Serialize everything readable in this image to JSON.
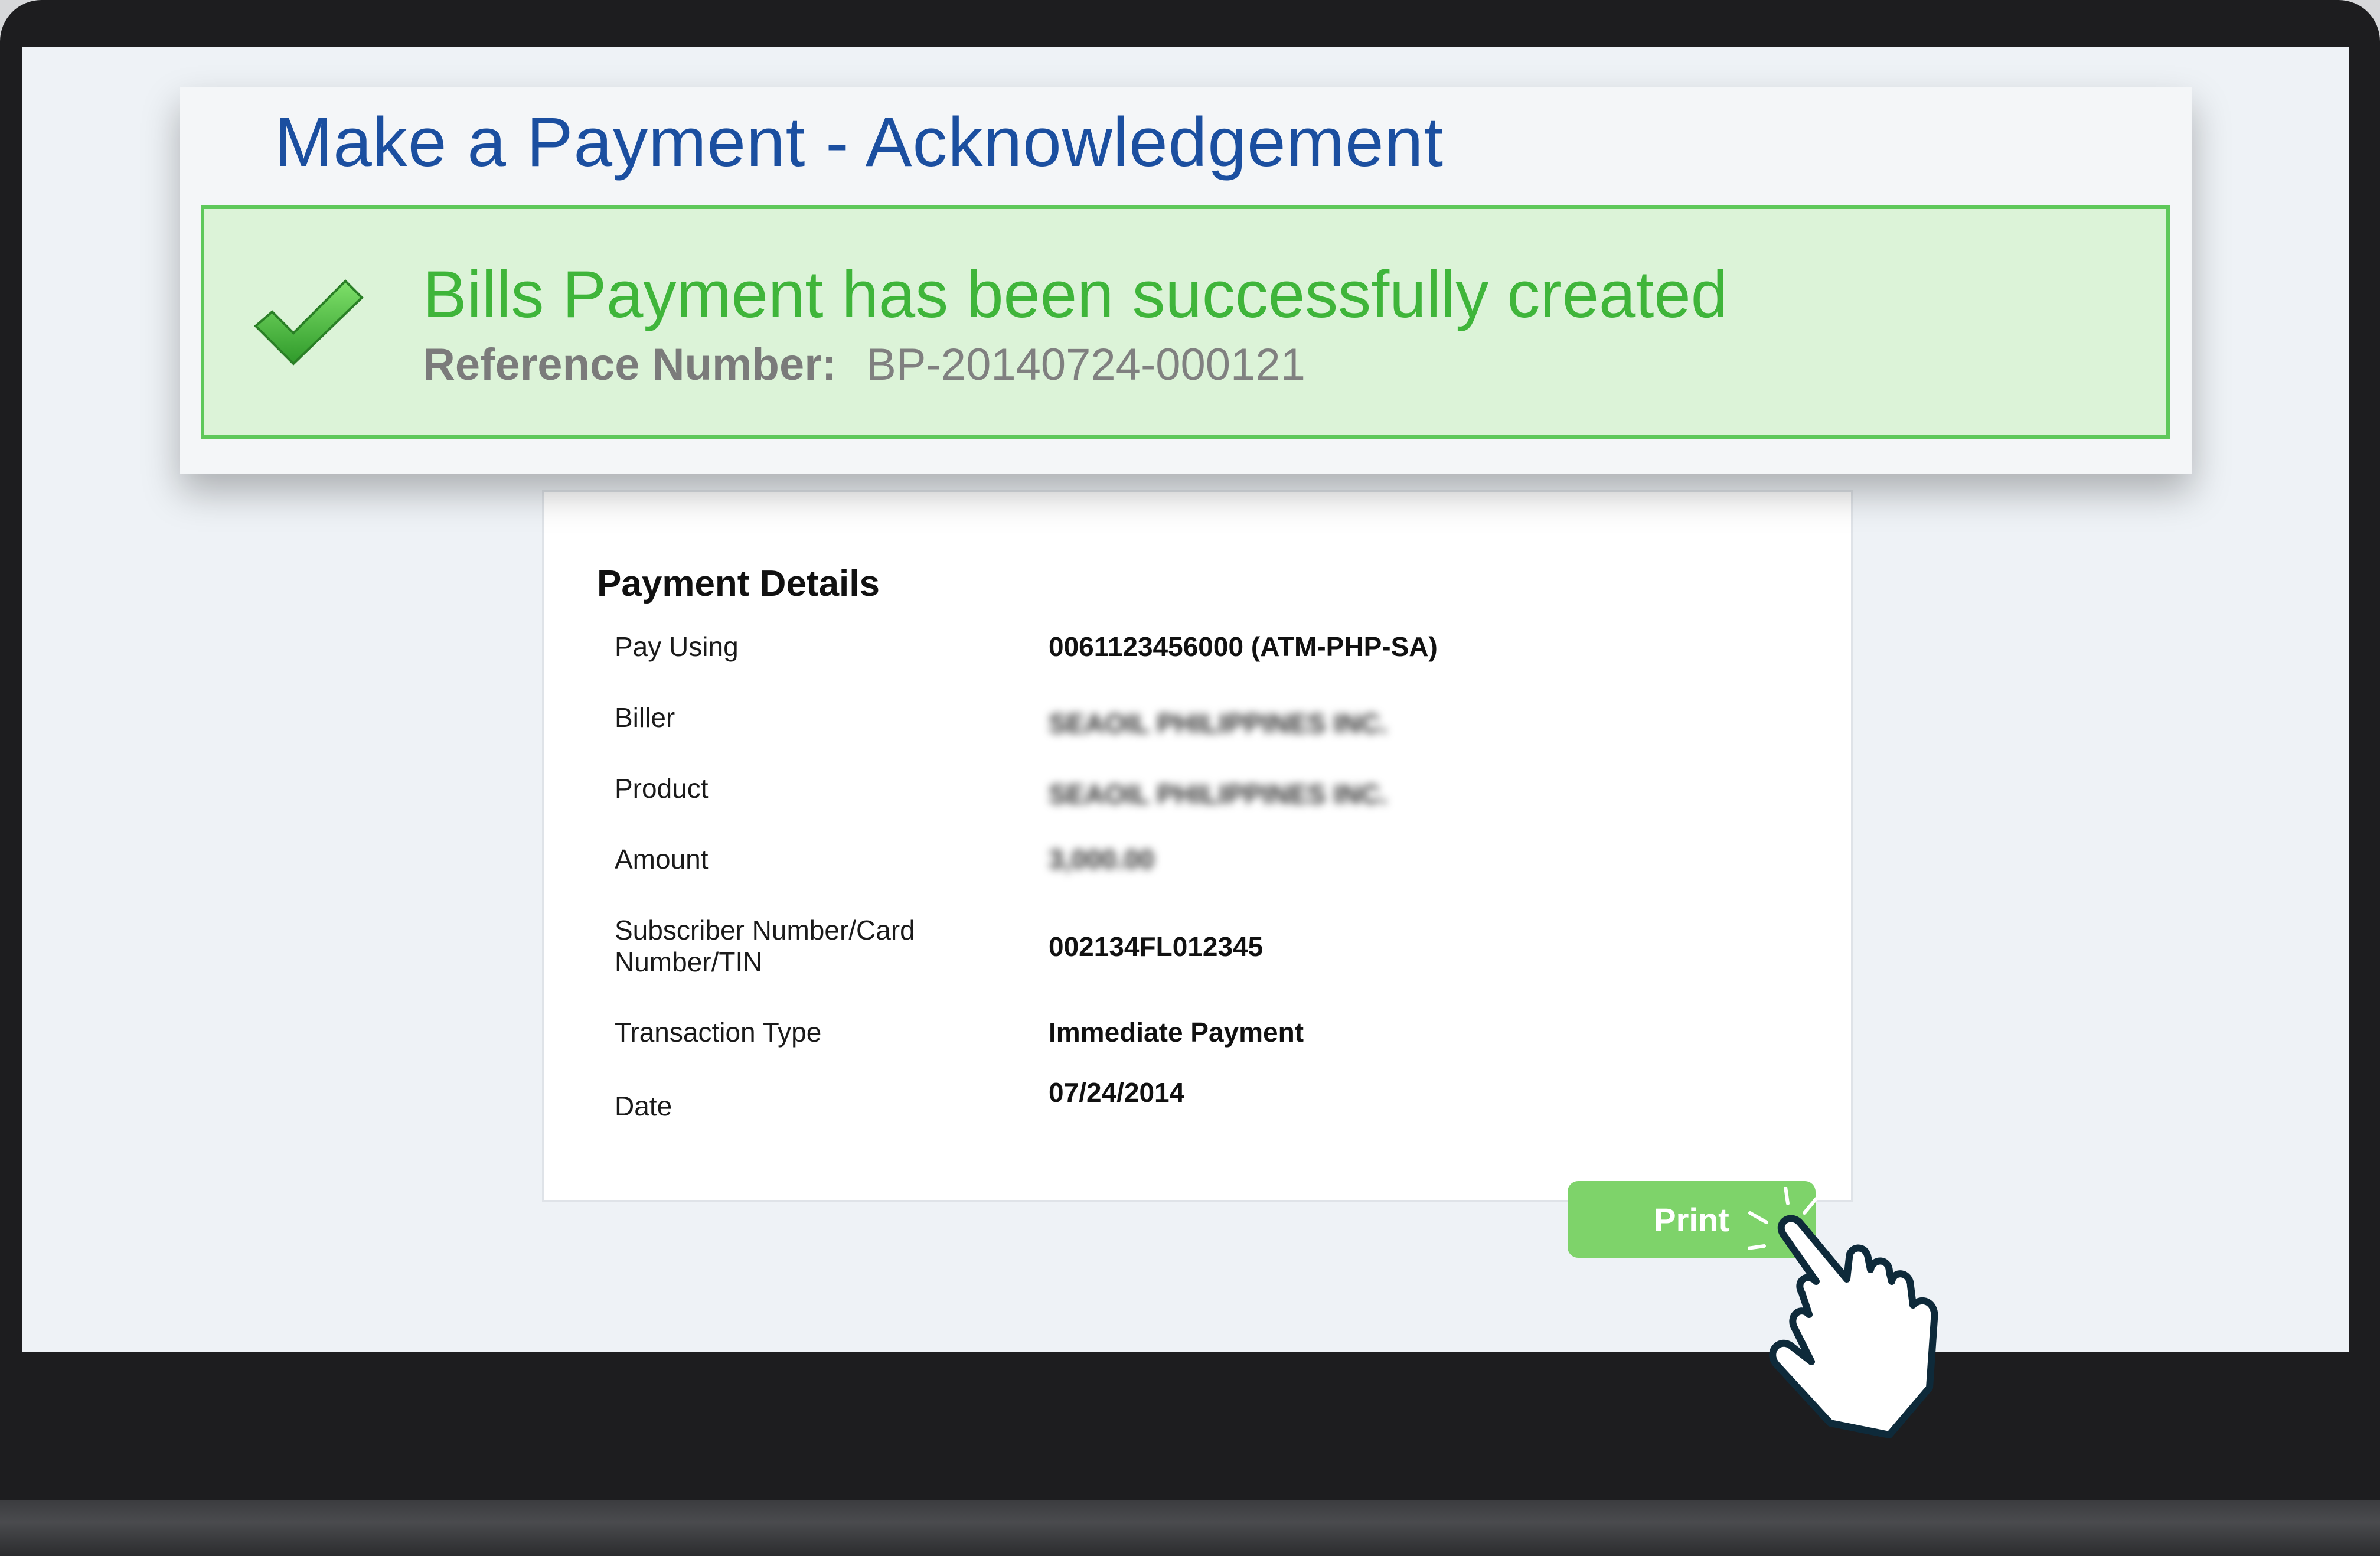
{
  "header": {
    "title": "Make a Payment - Acknowledgement"
  },
  "alert": {
    "message": "Bills Payment has been successfully created",
    "reference_label": "Reference Number:",
    "reference_value": "BP-20140724-000121",
    "icon": "check-icon",
    "color": "#3fb53a"
  },
  "details": {
    "title": "Payment Details",
    "rows": [
      {
        "label": "Pay Using",
        "value": "0061123456000 (ATM-PHP-SA)"
      },
      {
        "label": "Biller",
        "value": "SEAOIL PHILIPPINES INC."
      },
      {
        "label": "Product",
        "value": "SEAOIL PHILIPPINES INC."
      },
      {
        "label": "Amount",
        "value": "3,000.00"
      },
      {
        "label": "Subscriber Number/Card Number/TIN",
        "value": "002134FL012345"
      },
      {
        "label": "Transaction Type",
        "value": "Immediate Payment"
      },
      {
        "label": "Date",
        "value": "07/24/2014"
      }
    ]
  },
  "actions": {
    "print_label": "Print",
    "print_color": "#7ed36a"
  }
}
